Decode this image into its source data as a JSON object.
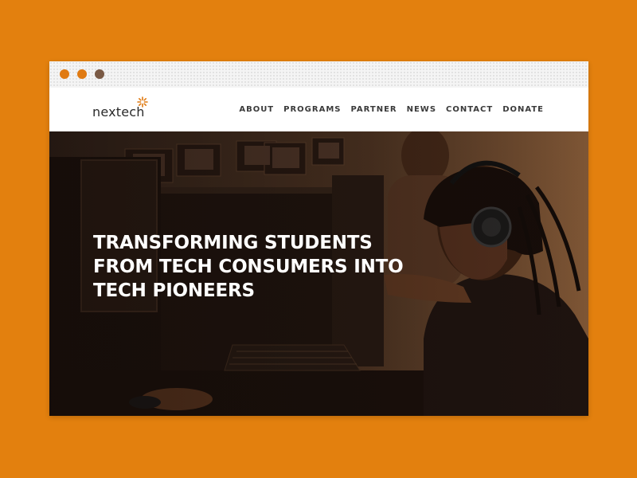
{
  "brand": {
    "name": "nextech"
  },
  "nav": {
    "items": [
      {
        "label": "ABOUT"
      },
      {
        "label": "PROGRAMS"
      },
      {
        "label": "PARTNER"
      },
      {
        "label": "NEWS"
      },
      {
        "label": "CONTACT"
      },
      {
        "label": "DONATE"
      }
    ]
  },
  "hero": {
    "headline_lines": [
      "TRANSFORMING STUDENTS",
      "FROM TECH CONSUMERS INTO",
      "TECH PIONEERS"
    ],
    "image_subject": "student-with-headphones-at-computer-lab"
  },
  "colors": {
    "page_background": "#E3800E",
    "accent": "#E07A12",
    "hero_overlay": "#2a1a12"
  },
  "icons": [
    "window-dot-icon",
    "logo-spark-icon"
  ]
}
